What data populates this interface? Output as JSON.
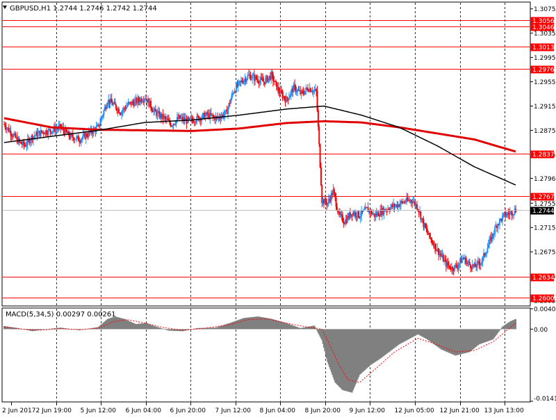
{
  "main_header": {
    "text": "GBPUSD,H1  1.2744 1.2746 1.2742 1.2744",
    "arrow_icon": "triangle-down-icon"
  },
  "macd_header": {
    "text": "MACD(5,34,5) 0.00297 0.00261"
  },
  "colors": {
    "background": "#ffffff",
    "frame": "#000000",
    "grid": "#000000",
    "bull_candle": "#1e90ff",
    "bear_candle": "#ff0000",
    "ma_slow": "#e00000",
    "ma_fast": "#000000",
    "level_line": "#ff0000",
    "macd_hist": "#808080",
    "macd_signal": "#ff0000"
  },
  "chart_data": [
    {
      "type": "candlestick",
      "symbol": "GBPUSD",
      "timeframe": "H1",
      "ylim": [
        1.2587,
        1.3085
      ],
      "y_ticks": [
        "1.3075",
        "1.3035",
        "1.2995",
        "1.2955",
        "1.2915",
        "1.2875",
        "1.2835",
        "1.2796",
        "1.2755",
        "1.2715",
        "1.2675",
        "1.2635",
        "1.2595"
      ],
      "x_tick_labels": [
        "2 Jun 2017",
        "2 Jun 19:00",
        "5 Jun 12:00",
        "6 Jun 04:00",
        "6 Jun 20:00",
        "7 Jun 12:00",
        "8 Jun 04:00",
        "8 Jun 20:00",
        "9 Jun 12:00",
        "12 Jun 05:00",
        "12 Jun 21:00",
        "13 Jun 13:00"
      ],
      "grid": true,
      "horizontal_levels": [
        "1.3056",
        "1.3046",
        "1.3013",
        "1.2976",
        "1.2837",
        "1.2767",
        "1.2634",
        "1.2600"
      ],
      "current_price": "1.2744",
      "close_path": [
        [
          0,
          1.2885
        ],
        [
          8,
          1.287
        ],
        [
          16,
          1.2855
        ],
        [
          22,
          1.285
        ],
        [
          30,
          1.2865
        ],
        [
          40,
          1.2872
        ],
        [
          50,
          1.2875
        ],
        [
          60,
          1.288
        ],
        [
          70,
          1.2865
        ],
        [
          80,
          1.286
        ],
        [
          90,
          1.287
        ],
        [
          100,
          1.288
        ],
        [
          110,
          1.2925
        ],
        [
          118,
          1.2915
        ],
        [
          124,
          1.2905
        ],
        [
          132,
          1.2918
        ],
        [
          140,
          1.2922
        ],
        [
          150,
          1.293
        ],
        [
          160,
          1.2905
        ],
        [
          170,
          1.2895
        ],
        [
          178,
          1.2885
        ],
        [
          186,
          1.2895
        ],
        [
          196,
          1.289
        ],
        [
          206,
          1.2895
        ],
        [
          216,
          1.29
        ],
        [
          226,
          1.2895
        ],
        [
          236,
          1.2903
        ],
        [
          244,
          1.294
        ],
        [
          252,
          1.2955
        ],
        [
          260,
          1.2965
        ],
        [
          268,
          1.296
        ],
        [
          276,
          1.2955
        ],
        [
          284,
          1.2965
        ],
        [
          292,
          1.294
        ],
        [
          300,
          1.2925
        ],
        [
          308,
          1.2945
        ],
        [
          316,
          1.2935
        ],
        [
          324,
          1.2945
        ],
        [
          332,
          1.2938
        ],
        [
          338,
          1.276
        ],
        [
          344,
          1.2755
        ],
        [
          350,
          1.2775
        ],
        [
          356,
          1.2735
        ],
        [
          362,
          1.2725
        ],
        [
          370,
          1.274
        ],
        [
          378,
          1.2735
        ],
        [
          386,
          1.2745
        ],
        [
          394,
          1.2735
        ],
        [
          402,
          1.2742
        ],
        [
          410,
          1.2748
        ],
        [
          418,
          1.2752
        ],
        [
          426,
          1.2758
        ],
        [
          434,
          1.276
        ],
        [
          440,
          1.2748
        ],
        [
          446,
          1.272
        ],
        [
          452,
          1.27
        ],
        [
          458,
          1.2685
        ],
        [
          464,
          1.267
        ],
        [
          470,
          1.2655
        ],
        [
          476,
          1.2648
        ],
        [
          482,
          1.2652
        ],
        [
          488,
          1.2665
        ],
        [
          494,
          1.2655
        ],
        [
          500,
          1.265
        ],
        [
          508,
          1.266
        ],
        [
          516,
          1.269
        ],
        [
          524,
          1.272
        ],
        [
          532,
          1.2735
        ],
        [
          540,
          1.274
        ],
        [
          544,
          1.2744
        ]
      ],
      "ma_slow_path": [
        [
          0,
          1.2895
        ],
        [
          50,
          1.288
        ],
        [
          100,
          1.2876
        ],
        [
          150,
          1.2875
        ],
        [
          200,
          1.2874
        ],
        [
          250,
          1.2878
        ],
        [
          300,
          1.2887
        ],
        [
          340,
          1.289
        ],
        [
          380,
          1.2888
        ],
        [
          420,
          1.288
        ],
        [
          460,
          1.287
        ],
        [
          500,
          1.286
        ],
        [
          544,
          1.284
        ]
      ],
      "ma_fast_path": [
        [
          0,
          1.2855
        ],
        [
          50,
          1.2865
        ],
        [
          100,
          1.2875
        ],
        [
          150,
          1.2888
        ],
        [
          200,
          1.2892
        ],
        [
          250,
          1.29
        ],
        [
          300,
          1.291
        ],
        [
          340,
          1.2915
        ],
        [
          380,
          1.29
        ],
        [
          420,
          1.288
        ],
        [
          460,
          1.285
        ],
        [
          500,
          1.2815
        ],
        [
          544,
          1.2785
        ]
      ]
    },
    {
      "type": "bar",
      "indicator": "MACD(5,34,5)",
      "ylim": [
        -0.01419,
        0.00402
      ],
      "y_ticks": [
        "0.00402",
        "0.00",
        "-0.01419"
      ],
      "hist_path": [
        [
          0,
          0.0006
        ],
        [
          15,
          0.0002
        ],
        [
          30,
          -0.0004
        ],
        [
          45,
          0.0
        ],
        [
          60,
          0.0003
        ],
        [
          80,
          -0.0002
        ],
        [
          100,
          0.0004
        ],
        [
          110,
          0.002
        ],
        [
          118,
          0.0025
        ],
        [
          128,
          0.002
        ],
        [
          140,
          0.001
        ],
        [
          150,
          0.0012
        ],
        [
          160,
          0.0006
        ],
        [
          175,
          -0.0003
        ],
        [
          190,
          -0.0004
        ],
        [
          205,
          0.0002
        ],
        [
          225,
          0.0003
        ],
        [
          240,
          0.0012
        ],
        [
          255,
          0.0022
        ],
        [
          270,
          0.0025
        ],
        [
          285,
          0.002
        ],
        [
          300,
          0.0012
        ],
        [
          315,
          0.0002
        ],
        [
          330,
          0.0007
        ],
        [
          338,
          -0.0022
        ],
        [
          344,
          -0.0065
        ],
        [
          352,
          -0.0105
        ],
        [
          360,
          -0.012
        ],
        [
          370,
          -0.0125
        ],
        [
          378,
          -0.009
        ],
        [
          390,
          -0.007
        ],
        [
          400,
          -0.0058
        ],
        [
          420,
          -0.003
        ],
        [
          440,
          -0.001
        ],
        [
          450,
          -0.002
        ],
        [
          465,
          -0.004
        ],
        [
          480,
          -0.0052
        ],
        [
          495,
          -0.0045
        ],
        [
          505,
          -0.003
        ],
        [
          520,
          -0.002
        ],
        [
          530,
          0.0005
        ],
        [
          538,
          0.0015
        ],
        [
          544,
          0.002
        ]
      ],
      "signal_path": [
        [
          0,
          0.0004
        ],
        [
          20,
          0.0
        ],
        [
          40,
          -0.0002
        ],
        [
          60,
          0.0001
        ],
        [
          80,
          -0.0001
        ],
        [
          100,
          0.0002
        ],
        [
          115,
          0.0014
        ],
        [
          130,
          0.0019
        ],
        [
          150,
          0.0012
        ],
        [
          170,
          0.0003
        ],
        [
          190,
          -0.0002
        ],
        [
          210,
          0.0001
        ],
        [
          240,
          0.0009
        ],
        [
          260,
          0.0019
        ],
        [
          280,
          0.002
        ],
        [
          300,
          0.0012
        ],
        [
          320,
          0.0005
        ],
        [
          338,
          0.0
        ],
        [
          346,
          -0.003
        ],
        [
          356,
          -0.007
        ],
        [
          366,
          -0.01
        ],
        [
          378,
          -0.0105
        ],
        [
          395,
          -0.0078
        ],
        [
          415,
          -0.0045
        ],
        [
          440,
          -0.0018
        ],
        [
          460,
          -0.003
        ],
        [
          480,
          -0.0045
        ],
        [
          500,
          -0.0042
        ],
        [
          520,
          -0.0025
        ],
        [
          535,
          -0.0002
        ],
        [
          544,
          0.0012
        ]
      ]
    }
  ]
}
